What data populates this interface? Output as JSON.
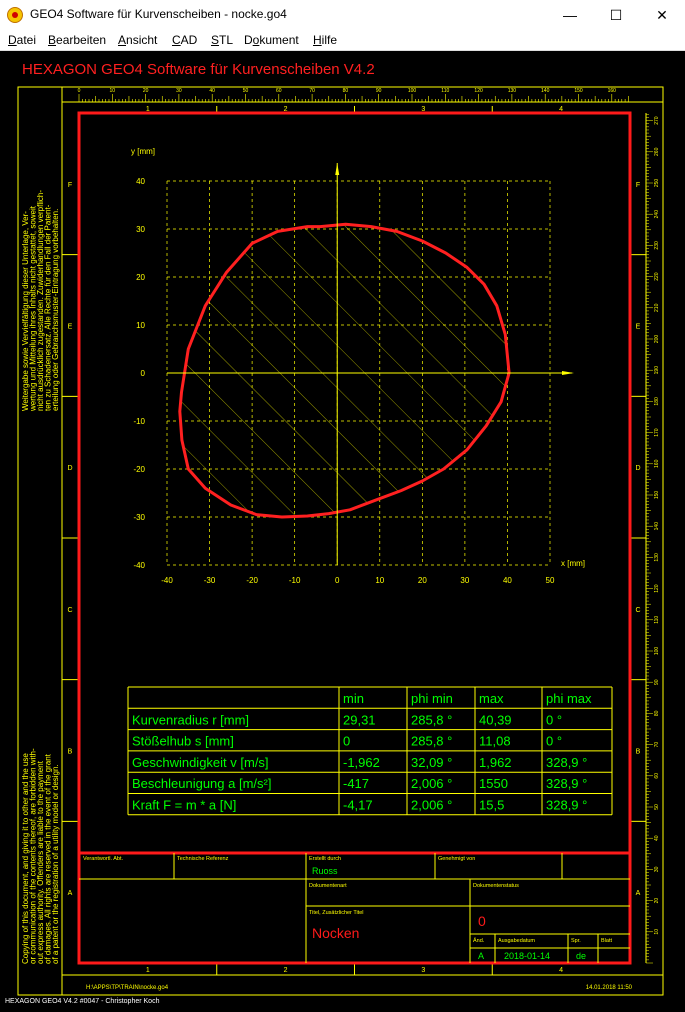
{
  "window": {
    "title": "GEO4  Software für Kurvenscheiben  -  nocke.go4",
    "minimize_glyph": "—",
    "maximize_glyph": "☐",
    "close_glyph": "✕"
  },
  "menu": [
    {
      "label": "Datei",
      "underline": "D"
    },
    {
      "label": "Bearbeiten",
      "underline": "B"
    },
    {
      "label": "Ansicht",
      "underline": "A"
    },
    {
      "label": "CAD",
      "underline": "C"
    },
    {
      "label": "STL",
      "underline": "S"
    },
    {
      "label": "Dokument",
      "underline": "o"
    },
    {
      "label": "Hilfe",
      "underline": "H"
    }
  ],
  "drawing": {
    "header": "HEXAGON   GEO4  Software für Kurvenscheiben  V4.2",
    "top_ruler_labels": [
      "0",
      "10",
      "20",
      "30",
      "40",
      "50",
      "60",
      "70",
      "80",
      "90",
      "100",
      "110",
      "120",
      "130",
      "140",
      "150",
      "160"
    ],
    "right_ruler_labels": [
      "10",
      "20",
      "30",
      "40",
      "50",
      "60",
      "70",
      "80",
      "90",
      "100",
      "110",
      "120",
      "130",
      "140",
      "150",
      "160",
      "170",
      "180",
      "190",
      "200",
      "210",
      "220",
      "230",
      "240",
      "250",
      "260",
      "270"
    ],
    "zone_columns": [
      "1",
      "2",
      "3",
      "4"
    ],
    "zone_rows": [
      "F",
      "E",
      "D",
      "C",
      "B",
      "A"
    ],
    "left_note_top": [
      "Weitergabe sowie Vervielfältigung dieser Unterlage, Ver-",
      "wertung und Mitteilung ihres Inhalts nicht gestattet, soweit",
      "nicht ausdrücklich zugestanden. Zuwiderhandlungen verpflich-",
      "ten zu Schadenersatz. Alle Rechte für den Fall der Patent-",
      "erteilung oder Gebrauchsmuster-Eintragung vorbehalten."
    ],
    "left_note_bottom": [
      "Copying of this document, and giving it to other and the use",
      "or communication of the contents thereof, are forbidden with-",
      "out express authority. Offenders are liable to the payment",
      "of damages. All rights are reserved in the event of the grant",
      "of a patent or the registration of a utility model or design."
    ],
    "file_path": "H:\\APPS\\TP\\TRAIN\\nocke.go4",
    "print_date": "14.01.2018 11:50"
  },
  "chart_data": {
    "type": "line",
    "title": "",
    "xlabel": "x [mm]",
    "ylabel": "y [mm]",
    "xlim": [
      -40,
      50
    ],
    "ylim": [
      -40,
      40
    ],
    "xticks": [
      -40,
      -30,
      -20,
      -10,
      0,
      10,
      20,
      30,
      40,
      50
    ],
    "yticks": [
      -40,
      -30,
      -20,
      -10,
      0,
      10,
      20,
      30,
      40
    ],
    "grid": true,
    "hatched": true,
    "series": [
      {
        "color": "#ff2020",
        "x": [
          40.39,
          39.5,
          37.5,
          34.5,
          30.5,
          25.5,
          20,
          14,
          8,
          2,
          -4,
          -7,
          -14,
          -20,
          -26,
          -31,
          -35,
          -36.6,
          -37,
          -36.5,
          -35,
          -31,
          -25,
          -19,
          -13,
          -7,
          -2,
          3,
          9,
          15,
          20,
          25,
          30.5,
          35,
          38.5,
          40.39
        ],
        "y": [
          0,
          8,
          14,
          18.5,
          22,
          25,
          27.5,
          29.5,
          30.5,
          31,
          30.5,
          30.5,
          29.5,
          27,
          21,
          14,
          5,
          -4,
          -8,
          -14,
          -20,
          -24,
          -27.5,
          -29.5,
          -30,
          -29.8,
          -29.3,
          -28.5,
          -26.5,
          -24.5,
          -22.5,
          -20,
          -16,
          -11,
          -6,
          0
        ]
      }
    ]
  },
  "table": {
    "headers": [
      "",
      "min",
      "phi min",
      "max",
      "phi max"
    ],
    "rows": [
      [
        "Kurvenradius r [mm]",
        "29,31",
        "285,8 °",
        "40,39",
        "0 °"
      ],
      [
        "Stößelhub s [mm]",
        "0",
        "285,8 °",
        "11,08",
        "0 °"
      ],
      [
        "Geschwindigkeit v [m/s]",
        "-1,962",
        "32,09 °",
        "1,962",
        "328,9 °"
      ],
      [
        "Beschleunigung a [m/s²]",
        "-417",
        "2,006 °",
        "1550",
        "328,9 °"
      ],
      [
        "Kraft F = m * a [N]",
        "-4,17",
        "2,006 °",
        "15,5",
        "328,9 °"
      ]
    ]
  },
  "title_block": {
    "verantwortl": "Verantwortl. Abt.",
    "tech_ref": "Technische Referenz",
    "erstellt_label": "Erstellt durch",
    "erstellt_value": "Ruoss",
    "genehmigt": "Genehmigt von",
    "dokumentenart": "Dokumentenart",
    "dokumentenstatus": "Dokumentenstatus",
    "titel_label": "Titel, Zusätzlicher Titel",
    "titel_value": "Nocken",
    "doc_number": "0",
    "aend_label": "Änd.",
    "aend_value": "A",
    "ausgabedatum_label": "Ausgabedatum",
    "ausgabedatum_value": "2018-01-14",
    "spr_label": "Spr.",
    "spr_value": "de",
    "blatt_label": "Blatt"
  },
  "footer": {
    "text": "HEXAGON GEO4 V4.2 #0047 - Christopher Koch"
  }
}
